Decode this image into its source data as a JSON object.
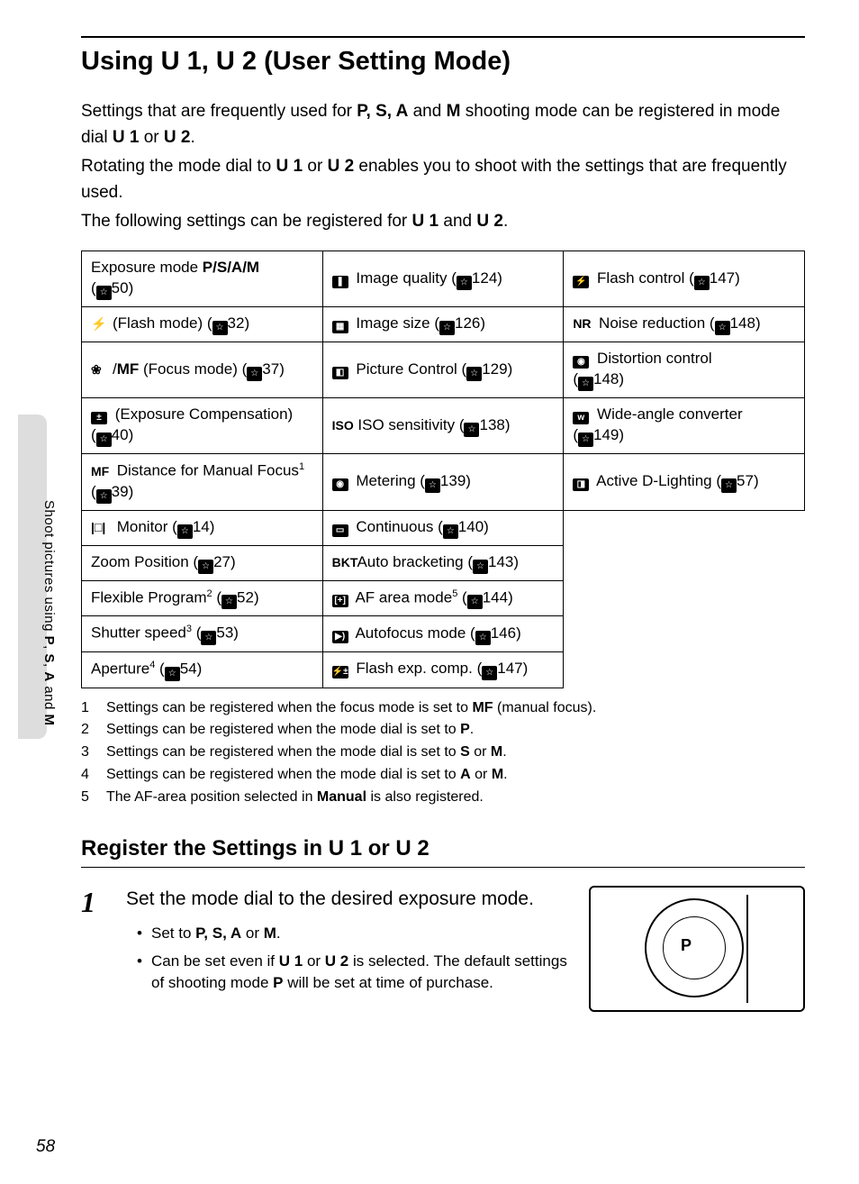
{
  "side_label": "Shoot pictures using P, S, A and M",
  "title_pre": "Using ",
  "title_u1": "U 1",
  "title_mid": ", ",
  "title_u2": "U 2",
  "title_post": " (User Setting Mode)",
  "intro": {
    "p1a": "Settings that are frequently used for ",
    "p1_modes": "P, S, A",
    "p1_and": " and ",
    "p1_m": "M",
    "p1b": " shooting mode can be registered in mode dial ",
    "p1_u1": "U 1",
    "p1_or": " or ",
    "p1_u2": "U 2",
    "p1_end": ".",
    "p2a": "Rotating the mode dial to ",
    "p2_u1": "U 1",
    "p2_or": " or ",
    "p2_u2": "U 2",
    "p2b": " enables you to shoot with the settings that are frequently used.",
    "p3a": "The following settings can be registered for ",
    "p3_u1": "U 1",
    "p3_and": " and ",
    "p3_u2": "U 2",
    "p3_end": "."
  },
  "table": {
    "r1c1a": "Exposure mode ",
    "r1c1b": "P/S/A/M",
    "r1c1_page": "50",
    "r1c2": "Image quality",
    "r1c2_page": "124",
    "r1c3": "Flash control",
    "r1c3_page": "147",
    "r2c1": "(Flash mode)",
    "r2c1_page": "32",
    "r2c2": "Image size",
    "r2c2_page": "126",
    "r2c3_icon": "NR",
    "r2c3": "Noise reduction",
    "r2c3_page": "148",
    "r3c1a": "/",
    "r3c1b": "MF",
    "r3c1c": " (Focus mode)",
    "r3c1_page": "37",
    "r3c2": "Picture Control",
    "r3c2_page": "129",
    "r3c3": "Distortion control",
    "r3c3_page": "148",
    "r4c1": "(Exposure Compensation)",
    "r4c1_page": "40",
    "r4c2_icon": "ISO",
    "r4c2": "ISO sensitivity",
    "r4c2_page": "138",
    "r4c3": "Wide-angle converter",
    "r4c3_page": "149",
    "r5c1_icon": "MF",
    "r5c1": "Distance for Manual Focus",
    "r5c1_sup": "1",
    "r5c1_page": "39",
    "r5c2": "Metering",
    "r5c2_page": "139",
    "r5c3": "Active D-Lighting",
    "r5c3_page": "57",
    "r6c1": "Monitor",
    "r6c1_page": "14",
    "r6c2": "Continuous",
    "r6c2_page": "140",
    "r7c1": "Zoom Position",
    "r7c1_page": "27",
    "r7c2_icon": "BKT",
    "r7c2": "Auto bracketing",
    "r7c2_page": "143",
    "r8c1": "Flexible Program",
    "r8c1_sup": "2",
    "r8c1_page": "52",
    "r8c2": "AF area mode",
    "r8c2_sup": "5",
    "r8c2_page": "144",
    "r9c1": "Shutter speed",
    "r9c1_sup": "3",
    "r9c1_page": "53",
    "r9c2": "Autofocus mode",
    "r9c2_page": "146",
    "r10c1": "Aperture",
    "r10c1_sup": "4",
    "r10c1_page": "54",
    "r10c2": "Flash exp. comp.",
    "r10c2_page": "147"
  },
  "footnotes": {
    "f1_num": "1",
    "f1a": "Settings can be registered when the focus mode is set to ",
    "f1_mf": "MF",
    "f1b": " (manual focus).",
    "f2_num": "2",
    "f2a": "Settings can be registered when the mode dial is set to ",
    "f2_p": "P",
    "f2b": ".",
    "f3_num": "3",
    "f3a": "Settings can be registered when the mode dial is set to ",
    "f3_s": "S",
    "f3_or": " or ",
    "f3_m": "M",
    "f3b": ".",
    "f4_num": "4",
    "f4a": "Settings can be registered when the mode dial is set to ",
    "f4_a": "A",
    "f4_or": " or ",
    "f4_m": "M",
    "f4b": ".",
    "f5_num": "5",
    "f5a": "The AF-area position selected in ",
    "f5_man": "Manual",
    "f5b": " is also registered."
  },
  "sub_title_pre": "Register the Settings in ",
  "sub_u1": "U 1",
  "sub_or": " or ",
  "sub_u2": "U 2",
  "step": {
    "num": "1",
    "heading": "Set the mode dial to the desired exposure mode.",
    "b1a": "Set to ",
    "b1_modes": "P, S, A",
    "b1_or": " or ",
    "b1_m": "M",
    "b1_end": ".",
    "b2a": "Can be set even if ",
    "b2_u1": "U 1",
    "b2_or": " or ",
    "b2_u2": "U 2",
    "b2b": " is selected. The default settings of shooting mode ",
    "b2_p": "P",
    "b2c": " will be set at time of purchase."
  },
  "dial_letter": "P",
  "page_number": "58"
}
